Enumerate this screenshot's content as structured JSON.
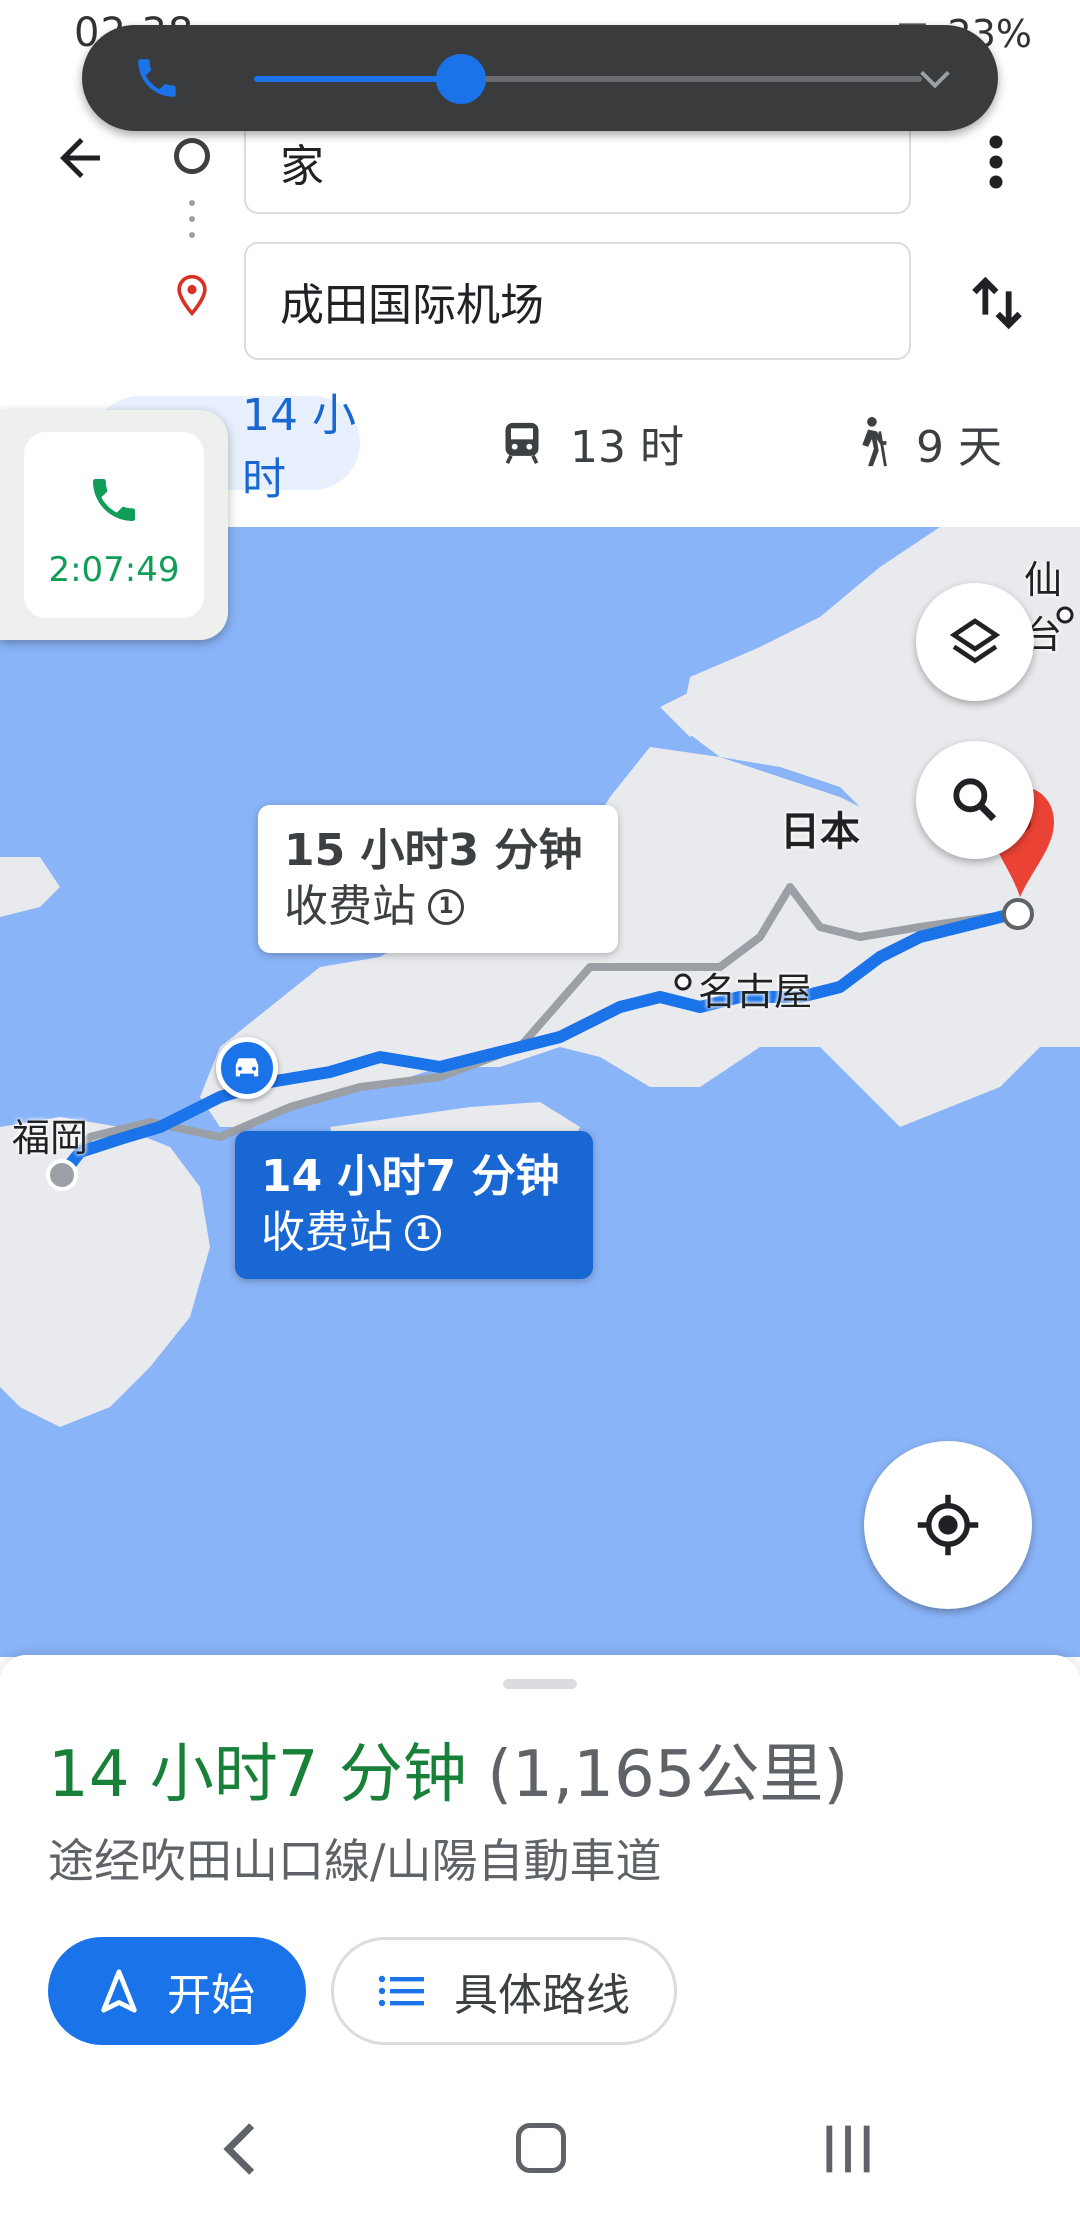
{
  "status_bar": {
    "time": "02:38",
    "battery": "23%"
  },
  "call_bar": {
    "slider_fraction": 0.31
  },
  "header": {
    "origin": "家",
    "destination": "成田国际机场"
  },
  "modes": [
    {
      "label": "14 小时",
      "icon": "car-icon",
      "selected": true
    },
    {
      "label": "13 时",
      "icon": "train-icon",
      "selected": false
    },
    {
      "label": "9 天",
      "icon": "walk-icon",
      "selected": false
    }
  ],
  "call_card": {
    "timer": "2:07:49"
  },
  "map": {
    "labels": {
      "sendai": "仙台",
      "japan": "日本",
      "nagoya": "名古屋",
      "fukuoka": "福岡"
    },
    "alt_route": {
      "time": "15 小时3 分钟",
      "toll": "收费站"
    },
    "main_route": {
      "time": "14 小时7 分钟",
      "toll": "收费站"
    },
    "colors": {
      "water": "#8ab4f8",
      "land": "#e8eaed",
      "route": "#4285f4",
      "alt_route": "#9aa0a6",
      "pin": "#ea4335"
    }
  },
  "sheet": {
    "time": "14 小时7 分钟",
    "distance": "(1,165公里)",
    "via": "途经吹田山口線/山陽自動車道",
    "start_label": "开始",
    "steps_label": "具体路线"
  }
}
